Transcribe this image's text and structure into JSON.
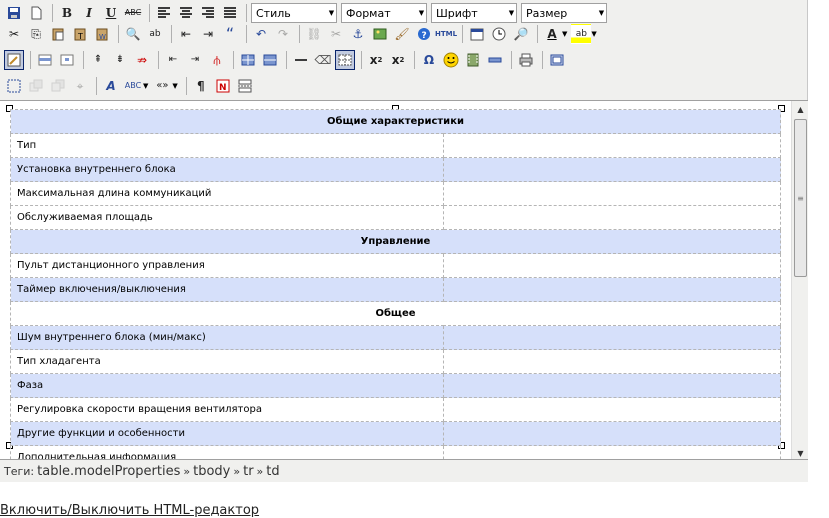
{
  "toolbar": {
    "style_select": "Стиль",
    "format_select": "Формат",
    "font_select": "Шрифт",
    "size_select": "Размер"
  },
  "table": {
    "rows": [
      {
        "type": "section",
        "shade": true,
        "label": "Общие характеристики"
      },
      {
        "type": "row",
        "shade": false,
        "label": "Тип",
        "value": ""
      },
      {
        "type": "row",
        "shade": true,
        "label": "Установка внутреннего блока",
        "value": ""
      },
      {
        "type": "row",
        "shade": false,
        "label": "Максимальная длина коммуникаций",
        "value": ""
      },
      {
        "type": "row",
        "shade": false,
        "label": "Обслуживаемая площадь",
        "value": ""
      },
      {
        "type": "section",
        "shade": true,
        "label": "Управление"
      },
      {
        "type": "row",
        "shade": false,
        "label": "Пульт дистанционного управления",
        "value": ""
      },
      {
        "type": "row",
        "shade": true,
        "label": "Таймер включения/выключения",
        "value": ""
      },
      {
        "type": "section",
        "shade": false,
        "label": "Общее"
      },
      {
        "type": "row",
        "shade": true,
        "label": "Шум внутреннего блока (мин/макс)",
        "value": ""
      },
      {
        "type": "row",
        "shade": false,
        "label": "Тип хладагента",
        "value": ""
      },
      {
        "type": "row",
        "shade": true,
        "label": "Фаза",
        "value": ""
      },
      {
        "type": "row",
        "shade": false,
        "label": "Регулировка скорости вращения вентилятора",
        "value": ""
      },
      {
        "type": "row",
        "shade": true,
        "label": "Другие функции и особенности",
        "value": ""
      },
      {
        "type": "row",
        "shade": false,
        "label": "Дополнительная информация",
        "value": ""
      }
    ]
  },
  "status": {
    "label": "Теги:",
    "path": [
      "table.modelProperties",
      "tbody",
      "tr",
      "td"
    ],
    "separator": "»"
  },
  "toggle_link": "Включить/Выключить HTML-редактор",
  "colors": {
    "shaded_row": "#d6e0fa",
    "toolbar_bg": "#f0f0ee",
    "active_button": "#c2cbe0"
  },
  "icons": {
    "row1": [
      "save-icon",
      "new-document-icon",
      "bold-icon",
      "italic-icon",
      "underline-icon",
      "strikethrough-icon",
      "align-left-icon",
      "align-center-icon",
      "align-right-icon",
      "align-justify-icon"
    ],
    "row2": [
      "cut-icon",
      "copy-icon",
      "paste-icon",
      "paste-text-icon",
      "paste-word-icon",
      "find-icon",
      "replace-icon",
      "outdent-icon",
      "indent-icon",
      "blockquote-icon",
      "undo-icon",
      "redo-icon",
      "link-icon",
      "unlink-icon",
      "anchor-icon",
      "image-icon",
      "cleanup-icon",
      "help-icon",
      "html-source-icon",
      "insert-date-icon",
      "insert-time-icon",
      "preview-icon",
      "text-color-icon",
      "background-color-icon"
    ],
    "row3": [
      "table-icon",
      "row-props-icon",
      "cell-props-icon",
      "insert-row-before-icon",
      "insert-row-after-icon",
      "delete-row-icon",
      "insert-col-before-icon",
      "insert-col-after-icon",
      "delete-col-icon",
      "split-cells-icon",
      "merge-cells-icon",
      "horizontal-rule-icon",
      "remove-format-icon",
      "visual-aid-icon",
      "subscript-icon",
      "superscript-icon",
      "special-char-icon",
      "emoticon-icon",
      "media-icon",
      "advanced-hr-icon",
      "print-icon",
      "fullscreen-icon"
    ],
    "row4": [
      "insert-layer-icon",
      "move-forward-icon",
      "move-backward-icon",
      "absolute-position-icon",
      "styles-icon",
      "spellcheck-icon",
      "direction-icon",
      "show-blocks-icon",
      "non-breaking-icon",
      "page-break-icon"
    ]
  }
}
